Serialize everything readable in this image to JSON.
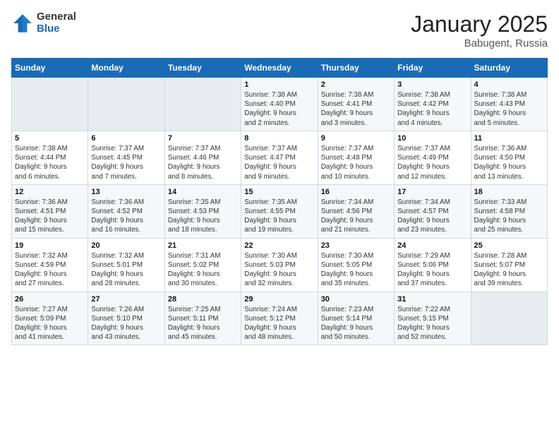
{
  "logo": {
    "general": "General",
    "blue": "Blue"
  },
  "title": "January 2025",
  "location": "Babugent, Russia",
  "days_of_week": [
    "Sunday",
    "Monday",
    "Tuesday",
    "Wednesday",
    "Thursday",
    "Friday",
    "Saturday"
  ],
  "weeks": [
    [
      {
        "day": "",
        "info": ""
      },
      {
        "day": "",
        "info": ""
      },
      {
        "day": "",
        "info": ""
      },
      {
        "day": "1",
        "info": "Sunrise: 7:38 AM\nSunset: 4:40 PM\nDaylight: 9 hours\nand 2 minutes."
      },
      {
        "day": "2",
        "info": "Sunrise: 7:38 AM\nSunset: 4:41 PM\nDaylight: 9 hours\nand 3 minutes."
      },
      {
        "day": "3",
        "info": "Sunrise: 7:38 AM\nSunset: 4:42 PM\nDaylight: 9 hours\nand 4 minutes."
      },
      {
        "day": "4",
        "info": "Sunrise: 7:38 AM\nSunset: 4:43 PM\nDaylight: 9 hours\nand 5 minutes."
      }
    ],
    [
      {
        "day": "5",
        "info": "Sunrise: 7:38 AM\nSunset: 4:44 PM\nDaylight: 9 hours\nand 6 minutes."
      },
      {
        "day": "6",
        "info": "Sunrise: 7:37 AM\nSunset: 4:45 PM\nDaylight: 9 hours\nand 7 minutes."
      },
      {
        "day": "7",
        "info": "Sunrise: 7:37 AM\nSunset: 4:46 PM\nDaylight: 9 hours\nand 8 minutes."
      },
      {
        "day": "8",
        "info": "Sunrise: 7:37 AM\nSunset: 4:47 PM\nDaylight: 9 hours\nand 9 minutes."
      },
      {
        "day": "9",
        "info": "Sunrise: 7:37 AM\nSunset: 4:48 PM\nDaylight: 9 hours\nand 10 minutes."
      },
      {
        "day": "10",
        "info": "Sunrise: 7:37 AM\nSunset: 4:49 PM\nDaylight: 9 hours\nand 12 minutes."
      },
      {
        "day": "11",
        "info": "Sunrise: 7:36 AM\nSunset: 4:50 PM\nDaylight: 9 hours\nand 13 minutes."
      }
    ],
    [
      {
        "day": "12",
        "info": "Sunrise: 7:36 AM\nSunset: 4:51 PM\nDaylight: 9 hours\nand 15 minutes."
      },
      {
        "day": "13",
        "info": "Sunrise: 7:36 AM\nSunset: 4:52 PM\nDaylight: 9 hours\nand 16 minutes."
      },
      {
        "day": "14",
        "info": "Sunrise: 7:35 AM\nSunset: 4:53 PM\nDaylight: 9 hours\nand 18 minutes."
      },
      {
        "day": "15",
        "info": "Sunrise: 7:35 AM\nSunset: 4:55 PM\nDaylight: 9 hours\nand 19 minutes."
      },
      {
        "day": "16",
        "info": "Sunrise: 7:34 AM\nSunset: 4:56 PM\nDaylight: 9 hours\nand 21 minutes."
      },
      {
        "day": "17",
        "info": "Sunrise: 7:34 AM\nSunset: 4:57 PM\nDaylight: 9 hours\nand 23 minutes."
      },
      {
        "day": "18",
        "info": "Sunrise: 7:33 AM\nSunset: 4:58 PM\nDaylight: 9 hours\nand 25 minutes."
      }
    ],
    [
      {
        "day": "19",
        "info": "Sunrise: 7:32 AM\nSunset: 4:59 PM\nDaylight: 9 hours\nand 27 minutes."
      },
      {
        "day": "20",
        "info": "Sunrise: 7:32 AM\nSunset: 5:01 PM\nDaylight: 9 hours\nand 28 minutes."
      },
      {
        "day": "21",
        "info": "Sunrise: 7:31 AM\nSunset: 5:02 PM\nDaylight: 9 hours\nand 30 minutes."
      },
      {
        "day": "22",
        "info": "Sunrise: 7:30 AM\nSunset: 5:03 PM\nDaylight: 9 hours\nand 32 minutes."
      },
      {
        "day": "23",
        "info": "Sunrise: 7:30 AM\nSunset: 5:05 PM\nDaylight: 9 hours\nand 35 minutes."
      },
      {
        "day": "24",
        "info": "Sunrise: 7:29 AM\nSunset: 5:06 PM\nDaylight: 9 hours\nand 37 minutes."
      },
      {
        "day": "25",
        "info": "Sunrise: 7:28 AM\nSunset: 5:07 PM\nDaylight: 9 hours\nand 39 minutes."
      }
    ],
    [
      {
        "day": "26",
        "info": "Sunrise: 7:27 AM\nSunset: 5:09 PM\nDaylight: 9 hours\nand 41 minutes."
      },
      {
        "day": "27",
        "info": "Sunrise: 7:26 AM\nSunset: 5:10 PM\nDaylight: 9 hours\nand 43 minutes."
      },
      {
        "day": "28",
        "info": "Sunrise: 7:25 AM\nSunset: 5:11 PM\nDaylight: 9 hours\nand 45 minutes."
      },
      {
        "day": "29",
        "info": "Sunrise: 7:24 AM\nSunset: 5:12 PM\nDaylight: 9 hours\nand 48 minutes."
      },
      {
        "day": "30",
        "info": "Sunrise: 7:23 AM\nSunset: 5:14 PM\nDaylight: 9 hours\nand 50 minutes."
      },
      {
        "day": "31",
        "info": "Sunrise: 7:22 AM\nSunset: 5:15 PM\nDaylight: 9 hours\nand 52 minutes."
      },
      {
        "day": "",
        "info": ""
      }
    ]
  ]
}
